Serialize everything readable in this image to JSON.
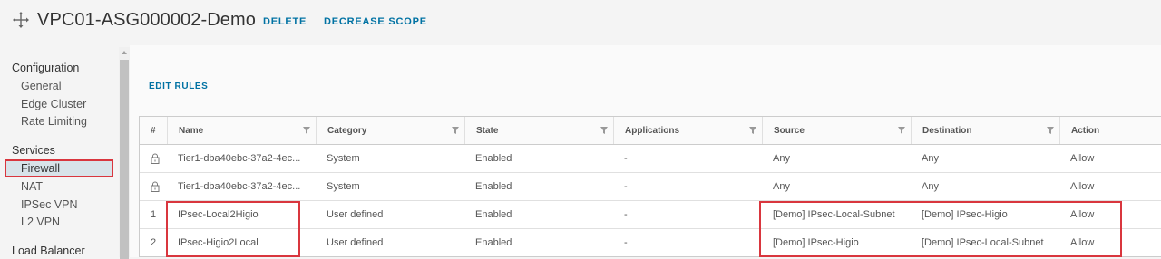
{
  "header": {
    "icon": "move-icon",
    "title": "VPC01-ASG000002-Demo",
    "delete_label": "DELETE",
    "decrease_scope_label": "DECREASE SCOPE"
  },
  "sidebar": {
    "configuration_title": "Configuration",
    "configuration_items": [
      "General",
      "Edge Cluster",
      "Rate Limiting"
    ],
    "services_title": "Services",
    "services_items": [
      "Firewall",
      "NAT",
      "IPSec VPN",
      "L2 VPN"
    ],
    "active_item": "Firewall",
    "load_balancer_title": "Load Balancer"
  },
  "main": {
    "edit_rules_label": "EDIT RULES",
    "columns": [
      "#",
      "Name",
      "Category",
      "State",
      "Applications",
      "Source",
      "Destination",
      "Action"
    ],
    "rows": [
      {
        "num": "",
        "locked": true,
        "name": "Tier1-dba40ebc-37a2-4ec...",
        "category": "System",
        "state": "Enabled",
        "applications": "-",
        "source": "Any",
        "destination": "Any",
        "action": "Allow"
      },
      {
        "num": "",
        "locked": true,
        "name": "Tier1-dba40ebc-37a2-4ec...",
        "category": "System",
        "state": "Enabled",
        "applications": "-",
        "source": "Any",
        "destination": "Any",
        "action": "Allow"
      },
      {
        "num": "1",
        "locked": false,
        "name": "IPsec-Local2Higio",
        "category": "User defined",
        "state": "Enabled",
        "applications": "-",
        "source": "[Demo] IPsec-Local-Subnet",
        "destination": "[Demo] IPsec-Higio",
        "action": "Allow"
      },
      {
        "num": "2",
        "locked": false,
        "name": "IPsec-Higio2Local",
        "category": "User defined",
        "state": "Enabled",
        "applications": "-",
        "source": "[Demo] IPsec-Higio",
        "destination": "[Demo] IPsec-Local-Subnet",
        "action": "Allow"
      }
    ]
  },
  "colors": {
    "link": "#0072a3",
    "highlight": "#d9363e",
    "active_bg": "#d8e3e9"
  }
}
